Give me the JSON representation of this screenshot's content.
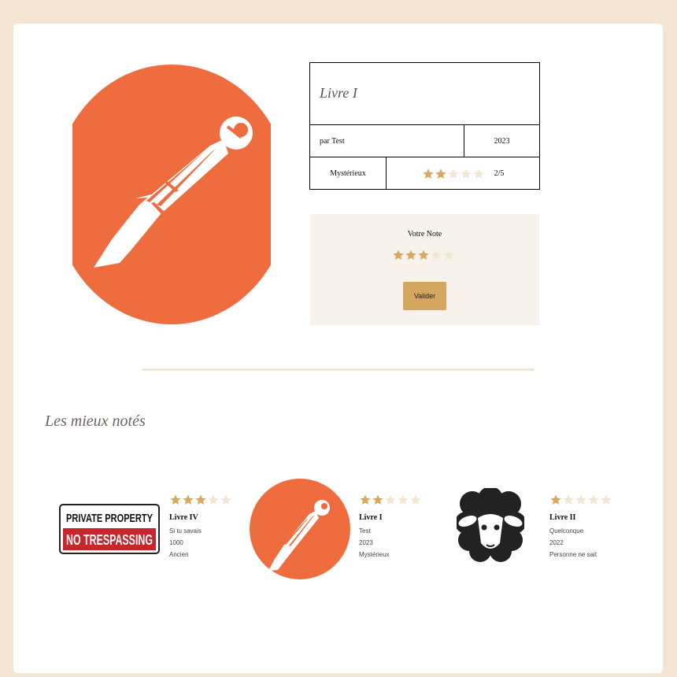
{
  "book": {
    "title": "Livre I",
    "author": "par Test",
    "year": "2023",
    "genre": "Mystérieux",
    "rating_value": 2,
    "rating_max": 5,
    "rating_text": "2/5",
    "cover_icon": "postman-logo-icon"
  },
  "vote": {
    "label": "Votre Note",
    "selected": 3,
    "max": 5,
    "submit_label": "Valider"
  },
  "top_rated": {
    "title": "Les mieux notés",
    "items": [
      {
        "name": "Livre IV",
        "author": "Si tu savais",
        "year": "1000",
        "genre": "Ancien",
        "rating": 3,
        "image": "private-property-sign-icon",
        "sign_line1": "PRIVATE PROPERTY",
        "sign_line2": "NO TRESPASSING"
      },
      {
        "name": "Livre I",
        "author": "Test",
        "year": "2023",
        "genre": "Mystérieux",
        "rating": 2,
        "image": "postman-logo-icon"
      },
      {
        "name": "Livre II",
        "author": "Quelconque",
        "year": "2022",
        "genre": "Personne ne sait",
        "rating": 1,
        "image": "sheep-icon"
      }
    ]
  },
  "colors": {
    "page_bg": "#f3e5d1",
    "star_filled": "#d9a95b",
    "star_empty": "#f2e6d3",
    "accent_orange": "#ef6c3f",
    "button": "#d4a65f"
  }
}
